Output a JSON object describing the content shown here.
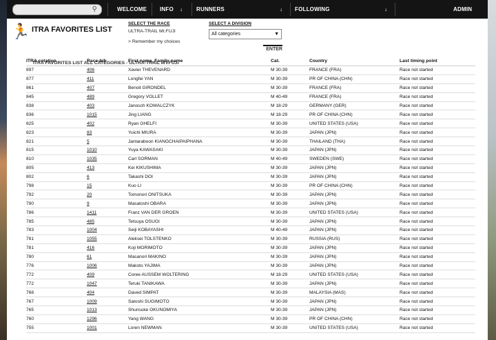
{
  "nav": {
    "welcome": "WELCOME",
    "info": "INFO",
    "runners": "RUNNERS",
    "following": "FOLLOWING",
    "admin_login": "ADMIN LOGIN"
  },
  "page": {
    "title": "ITRA FAVORITES LIST",
    "select_race_label": "SELECT THE RACE",
    "race_value": "ULTRA-TRAIL Mt.FUJI",
    "remember_label": "> Remember my choices",
    "select_division_label": "SELECT A DIVISION",
    "division_value": "All categories",
    "enter_label": "ENTER",
    "subtitle": "ITRA FAVORITES LIST ALL CATEGORIES - ULTRA-TRAIL MT.FUJI"
  },
  "table": {
    "headers": [
      "ITRA cotation",
      "Race-bib",
      "First name, Family name",
      "Cat.",
      "Country",
      "Last timing point"
    ],
    "rows": [
      [
        "897",
        "406",
        "Xavier THEVENARD",
        "M 30-39",
        "FRANCE (FRA)",
        "Race not started"
      ],
      [
        "877",
        "411",
        "Longfei YAN",
        "M 30-39",
        "PR OF CHINA (CHN)",
        "Race not started"
      ],
      [
        "861",
        "407",
        "Benoit GIRONDEL",
        "M 30-39",
        "FRANCE (FRA)",
        "Race not started"
      ],
      [
        "845",
        "489",
        "Gregory VOLLET",
        "M 40-49",
        "FRANCE (FRA)",
        "Race not started"
      ],
      [
        "838",
        "403",
        "Janosch KOWALCZYK",
        "M 18-29",
        "GERMANY (GER)",
        "Race not started"
      ],
      [
        "836",
        "1015",
        "Jing LIANG",
        "M 18-29",
        "PR OF CHINA (CHN)",
        "Race not started"
      ],
      [
        "825",
        "402",
        "Ryan GHELFI",
        "M 30-39",
        "UNITED STATES (USA)",
        "Race not started"
      ],
      [
        "823",
        "83",
        "Yuichi MIURA",
        "M 30-39",
        "JAPAN (JPN)",
        "Race not started"
      ],
      [
        "821",
        "5",
        "Jantaraboon KIANGCHAIPAIPHANA",
        "M 30-39",
        "THAILAND (THA)",
        "Race not started"
      ],
      [
        "815",
        "1010",
        "Yuya KAWASAKI",
        "M 30-39",
        "JAPAN (JPN)",
        "Race not started"
      ],
      [
        "810",
        "1035",
        "Carl SORMAN",
        "M 40-49",
        "SWEDEN (SWE)",
        "Race not started"
      ],
      [
        "805",
        "413",
        "Kei KIKUSHIMA",
        "M 30-39",
        "JAPAN (JPN)",
        "Race not started"
      ],
      [
        "802",
        "6",
        "Takashi DOI",
        "M 30-39",
        "JAPAN (JPN)",
        "Race not started"
      ],
      [
        "798",
        "15",
        "Kuo LI",
        "M 30-39",
        "PR OF CHINA (CHN)",
        "Race not started"
      ],
      [
        "792",
        "20",
        "Tomonori ONITSUKA",
        "M 30-39",
        "JAPAN (JPN)",
        "Race not started"
      ],
      [
        "790",
        "9",
        "Masatoshi OBARA",
        "M 30-39",
        "JAPAN (JPN)",
        "Race not started"
      ],
      [
        "786",
        "1411",
        "Franz VAN DER GROEN",
        "M 30-39",
        "UNITED STATES (USA)",
        "Race not started"
      ],
      [
        "785",
        "485",
        "Tetsuya OSUGI",
        "M 30-39",
        "JAPAN (JPN)",
        "Race not started"
      ],
      [
        "783",
        "1004",
        "Seiji KOBAYASHI",
        "M 40-49",
        "JAPAN (JPN)",
        "Race not started"
      ],
      [
        "781",
        "1055",
        "Aleksei TOLSTENKO",
        "M 30-39",
        "RUSSIA (RUS)",
        "Race not started"
      ],
      [
        "781",
        "416",
        "Koji MORIMOTO",
        "M 30-39",
        "JAPAN (JPN)",
        "Race not started"
      ],
      [
        "780",
        "61",
        "Masanori MAKINO",
        "M 30-39",
        "JAPAN (JPN)",
        "Race not started"
      ],
      [
        "776",
        "1006",
        "Makoto YAJIMA",
        "M 30-39",
        "JAPAN (JPN)",
        "Race not started"
      ],
      [
        "772",
        "409",
        "Coree AUSSEM WOLTERING",
        "M 18-29",
        "UNITED STATES (USA)",
        "Race not started"
      ],
      [
        "772",
        "1047",
        "Teruki TANIKAWA",
        "M 30-39",
        "JAPAN (JPN)",
        "Race not started"
      ],
      [
        "768",
        "404",
        "Daved SIMPAT",
        "M 30-39",
        "MALAYSIA (MAS)",
        "Race not started"
      ],
      [
        "767",
        "1009",
        "Satoshi SUGIMOTO",
        "M 30-39",
        "JAPAN (JPN)",
        "Race not started"
      ],
      [
        "765",
        "1013",
        "Shunsuke OKUNOMIYA",
        "M 30-39",
        "JAPAN (JPN)",
        "Race not started"
      ],
      [
        "760",
        "1296",
        "Yang WANG",
        "M 30-39",
        "PR OF CHINA (CHN)",
        "Race not started"
      ],
      [
        "755",
        "1001",
        "Loren NEWMAN",
        "M 30-39",
        "UNITED STATES (USA)",
        "Race not started"
      ]
    ]
  }
}
